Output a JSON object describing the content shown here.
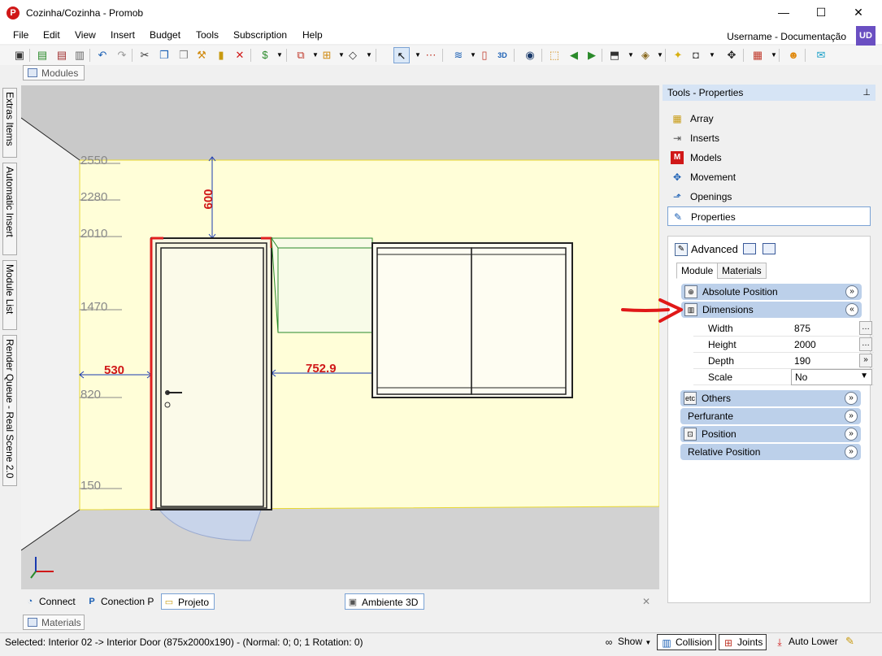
{
  "window": {
    "title": "Cozinha/Cozinha - Promob",
    "app_icon": "promob-logo-icon",
    "minimize": "—",
    "maximize": "☐",
    "close": "✕"
  },
  "menu": {
    "items": [
      "File",
      "Edit",
      "View",
      "Insert",
      "Budget",
      "Tools",
      "Subscription",
      "Help"
    ],
    "user_label": "Username - Documentação",
    "user_initials": "UD"
  },
  "modules_tab": "Modules",
  "materials_tab": "Materials",
  "side_tabs": [
    "Extras Items",
    "Automatic Insert",
    "Module List",
    "Render Queue - Real Scene 2.0"
  ],
  "viewport": {
    "ruler_labels": [
      "2550",
      "2280",
      "2010",
      "1470",
      "820",
      "150"
    ],
    "dim_labels": {
      "top": "600",
      "left": "530",
      "middle": "752.9"
    }
  },
  "bottom_tabs": [
    "Connect",
    "Conection P",
    "Projeto",
    "Ambiente 3D"
  ],
  "close_x": "✕",
  "status": {
    "selected_text": "Selected: Interior 02 -> Interior Door (875x2000x190) - (Normal: 0; 0; 1 Rotation: 0)",
    "show_label": "Show",
    "collision_label": "Collision",
    "joints_label": "Joints",
    "auto_lower_label": "Auto Lower"
  },
  "panel": {
    "header": "Tools - Properties",
    "tools": [
      {
        "label": "Array",
        "icon": "array-icon"
      },
      {
        "label": "Inserts",
        "icon": "inserts-icon"
      },
      {
        "label": "Models",
        "icon": "models-icon"
      },
      {
        "label": "Movement",
        "icon": "movement-icon"
      },
      {
        "label": "Openings",
        "icon": "openings-icon"
      },
      {
        "label": "Properties",
        "icon": "properties-icon"
      }
    ],
    "advanced_label": "Advanced",
    "subtabs": [
      "Module",
      "Materials"
    ],
    "sections": {
      "absolute_position": "Absolute Position",
      "dimensions": "Dimensions",
      "others": "Others",
      "others_icon_text": "etc",
      "perfurante": "Perfurante",
      "position": "Position",
      "relative_position": "Relative Position"
    },
    "properties": [
      {
        "name": "Width",
        "value": "875"
      },
      {
        "name": "Height",
        "value": "2000"
      },
      {
        "name": "Depth",
        "value": "190"
      },
      {
        "name": "Scale",
        "value": "No"
      }
    ]
  }
}
